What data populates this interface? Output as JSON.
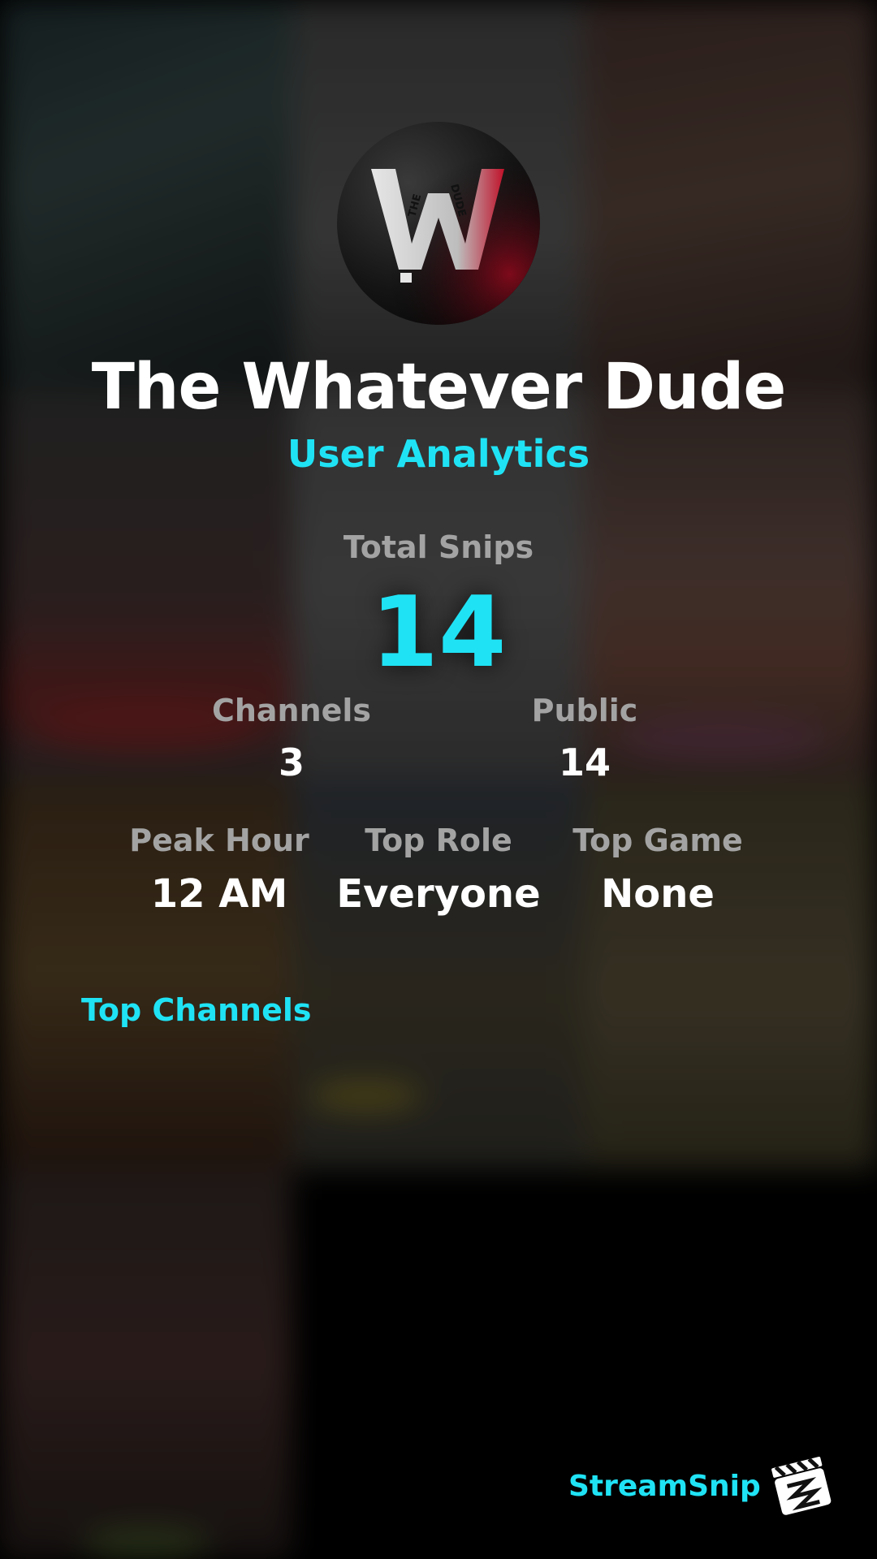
{
  "profile": {
    "avatar_text": "THE W DUDE",
    "name": "The Whatever Dude",
    "subtitle": "User Analytics"
  },
  "stats": {
    "total_snips_label": "Total Snips",
    "total_snips_value": "14",
    "channels_label": "Channels",
    "channels_value": "3",
    "public_label": "Public",
    "public_value": "14",
    "peak_hour_label": "Peak Hour",
    "peak_hour_value": "12 AM",
    "top_role_label": "Top Role",
    "top_role_value": "Everyone",
    "top_game_label": "Top Game",
    "top_game_value": "None"
  },
  "sections": {
    "top_channels_title": "Top Channels"
  },
  "brand": {
    "name": "StreamSnip",
    "logo_icon": "clapperboard-icon"
  },
  "colors": {
    "accent": "#1fe3f5",
    "label": "#a3a3a3",
    "value": "#ffffff",
    "avatar_red": "#c0122a"
  }
}
